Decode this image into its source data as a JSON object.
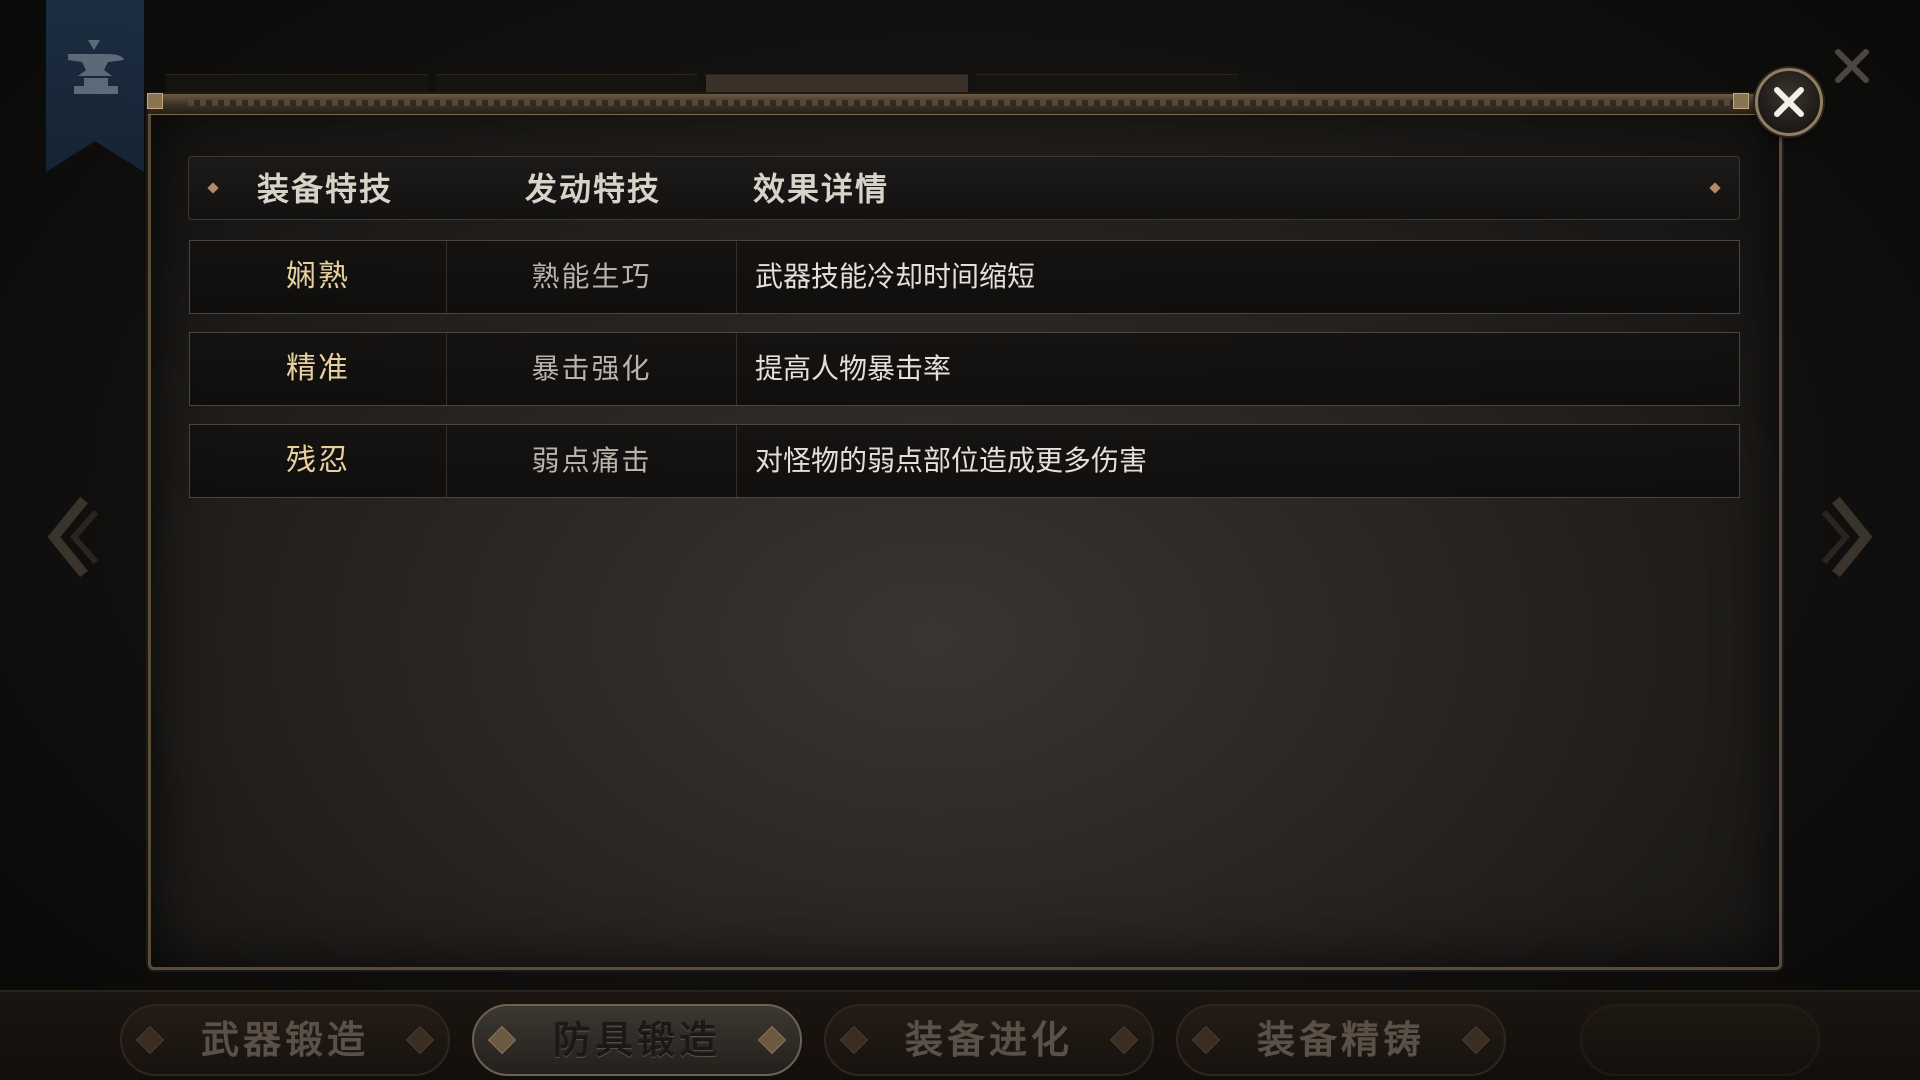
{
  "table": {
    "headers": [
      "装备特技",
      "发动特技",
      "效果详情"
    ],
    "rows": [
      {
        "equip_skill": "娴熟",
        "trigger_skill": "熟能生巧",
        "effect": "武器技能冷却时间缩短"
      },
      {
        "equip_skill": "精准",
        "trigger_skill": "暴击强化",
        "effect": "提高人物暴击率"
      },
      {
        "equip_skill": "残忍",
        "trigger_skill": "弱点痛击",
        "effect": "对怪物的弱点部位造成更多伤害"
      }
    ]
  },
  "bottom_tabs": [
    "武器锻造",
    "防具锻造",
    "装备进化",
    "装备精铸"
  ],
  "active_tab": "防具锻造",
  "icons": {
    "banner": "anvil-icon",
    "close": "close-icon",
    "prev": "chevron-left-icon",
    "next": "chevron-right-icon"
  },
  "colors": {
    "skill_name": "#e8cfa0",
    "panel_border": "#5a4c3a",
    "banner": "#20344c"
  }
}
